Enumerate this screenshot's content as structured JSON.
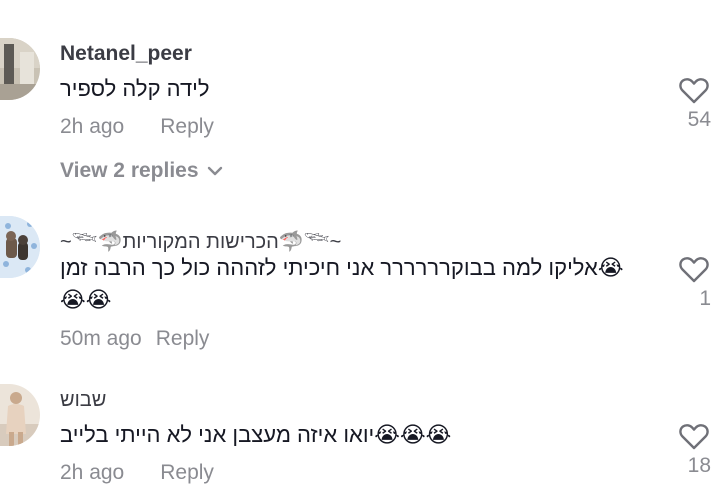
{
  "comments": [
    {
      "username": "Netanel_peer",
      "text": "לידה קלה לספיר",
      "time": "2h ago",
      "reply_label": "Reply",
      "likes": "54",
      "view_replies": "View 2 replies"
    },
    {
      "username": "~𓆝🦈הכרישות המקוריות🦈𓆝~",
      "text_line1": "😭אליקו למה בבוקרררררר אני חיכיתי לזההה כול כך הרבה זמן",
      "text_line2": "😭😭",
      "time": "50m ago",
      "reply_label": "Reply",
      "likes": "1"
    },
    {
      "username": "שבוש",
      "text": "😭😭😭יואו איזה מעצבן אני לא הייתי בלייב",
      "time": "2h ago",
      "reply_label": "Reply",
      "likes": "18"
    }
  ],
  "icons": {
    "like": "heart-outline-icon",
    "expand": "chevron-down-icon"
  },
  "colors": {
    "text": "#161823",
    "muted": "#8a8b91",
    "username": "#3b3c44"
  }
}
